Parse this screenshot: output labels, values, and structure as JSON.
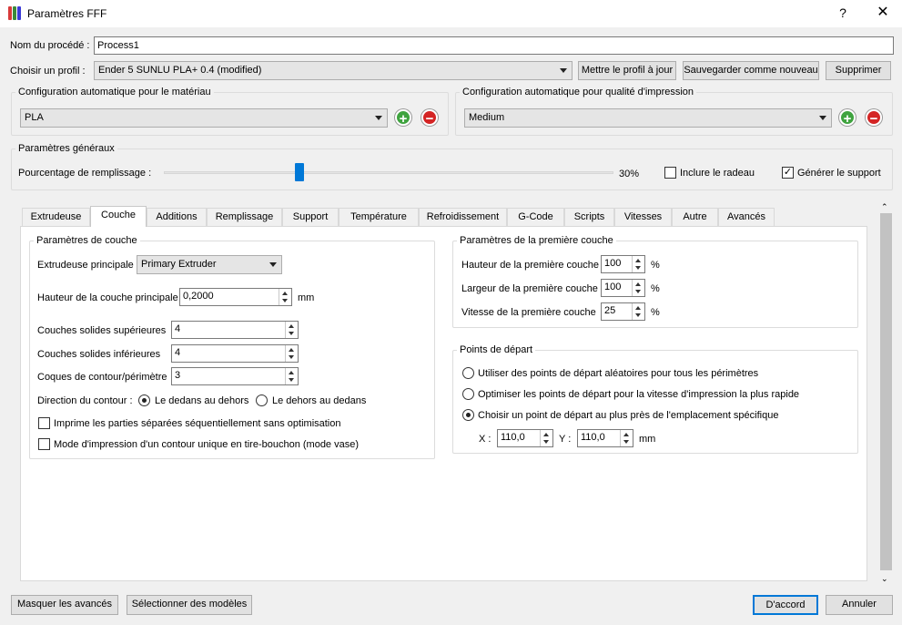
{
  "window": {
    "title": "Paramètres FFF",
    "help": "?",
    "close": "✕"
  },
  "process": {
    "label": "Nom du procédé :",
    "value": "Process1"
  },
  "profile": {
    "label": "Choisir un profil :",
    "value": "Ender 5 SUNLU PLA+ 0.4 (modified)",
    "update_btn": "Mettre le profil à jour",
    "save_btn": "Sauvegarder comme nouveau",
    "delete_btn": "Supprimer"
  },
  "material": {
    "title": "Configuration automatique pour le matériau",
    "value": "PLA"
  },
  "quality": {
    "title": "Configuration automatique pour qualité d'impression",
    "value": "Medium"
  },
  "general": {
    "title": "Paramètres généraux",
    "infill_label": "Pourcentage de remplissage :",
    "infill_value": "30%",
    "infill_fraction": 0.3,
    "raft_label": "Inclure le radeau",
    "raft_checked": false,
    "support_label": "Générer le support",
    "support_checked": true
  },
  "tabs": [
    "Extrudeuse",
    "Couche",
    "Additions",
    "Remplissage",
    "Support",
    "Température",
    "Refroidissement",
    "G-Code",
    "Scripts",
    "Vitesses",
    "Autre",
    "Avancés"
  ],
  "active_tab": "Couche",
  "layer": {
    "title": "Paramètres de couche",
    "extruder_label": "Extrudeuse principale",
    "extruder_value": "Primary Extruder",
    "height_label": "Hauteur de la couche principale",
    "height_value": "0,2000",
    "height_unit": "mm",
    "top_label": "Couches solides supérieures",
    "top_value": "4",
    "bottom_label": "Couches solides inférieures",
    "bottom_value": "4",
    "shells_label": "Coques de contour/périmètre",
    "shells_value": "3",
    "direction_label": "Direction du contour :",
    "dir_inside_out": "Le dedans au dehors",
    "dir_outside_in": "Le dehors au dedans",
    "sequential_label": "Imprime les parties séparées séquentiellement sans optimisation",
    "vase_label": "Mode d'impression d'un contour unique en tire-bouchon (mode vase)"
  },
  "first_layer": {
    "title": "Paramètres de la première couche",
    "height_label": "Hauteur de la première couche",
    "height_value": "100",
    "width_label": "Largeur de la première couche",
    "width_value": "100",
    "speed_label": "Vitesse de la première couche",
    "speed_value": "25",
    "unit": "%"
  },
  "start_points": {
    "title": "Points de départ",
    "random": "Utiliser des points de départ aléatoires pour tous les périmètres",
    "optimize": "Optimiser les points de départ pour la vitesse d'impression la plus rapide",
    "specific": "Choisir un point de départ au plus près de l'emplacement spécifique",
    "x_label": "X :",
    "x_value": "110,0",
    "y_label": "Y :",
    "y_value": "110,0",
    "unit": "mm"
  },
  "footer": {
    "hide_advanced": "Masquer les avancés",
    "select_models": "Sélectionner des modèles",
    "ok": "D'accord",
    "cancel": "Annuler"
  }
}
